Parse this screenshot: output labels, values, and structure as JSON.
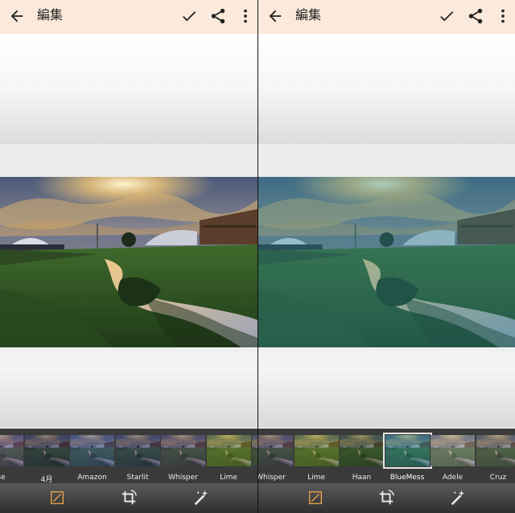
{
  "left": {
    "title": "編集",
    "filters": [
      {
        "label": "se",
        "tint": "#5b4a74"
      },
      {
        "label": "4月",
        "tint": "#2b2a4a"
      },
      {
        "label": "Amazon",
        "tint": "#3e4c84"
      },
      {
        "label": "Starlit",
        "tint": "#31355c"
      },
      {
        "label": "Whisper",
        "tint": "#4a3f5d"
      },
      {
        "label": "Lime",
        "tint": "#6a7a2e"
      },
      {
        "label": "",
        "tint": "#4d4d4d"
      }
    ]
  },
  "right": {
    "title": "編集",
    "filters": [
      {
        "label": "Whisper",
        "tint": "#4a3f5d"
      },
      {
        "label": "Lime",
        "tint": "#6a7a2e"
      },
      {
        "label": "Haan",
        "tint": "#394a2c"
      },
      {
        "label": "BlueMess",
        "tint": "#2f7b85",
        "selected": true
      },
      {
        "label": "Adele",
        "tint": "#8a8a8a"
      },
      {
        "label": "Cruz",
        "tint": "#5e5e5e"
      }
    ]
  },
  "colors": {
    "topbar_bg": "#fbeadb",
    "accent_orange": "#e8a04a",
    "filter_strip_bg": "#3a3a3a"
  },
  "icons": [
    "back-arrow-icon",
    "check-icon",
    "share-icon",
    "more-vert-icon",
    "adjust-icon",
    "crop-rotate-icon",
    "auto-enhance-icon"
  ]
}
